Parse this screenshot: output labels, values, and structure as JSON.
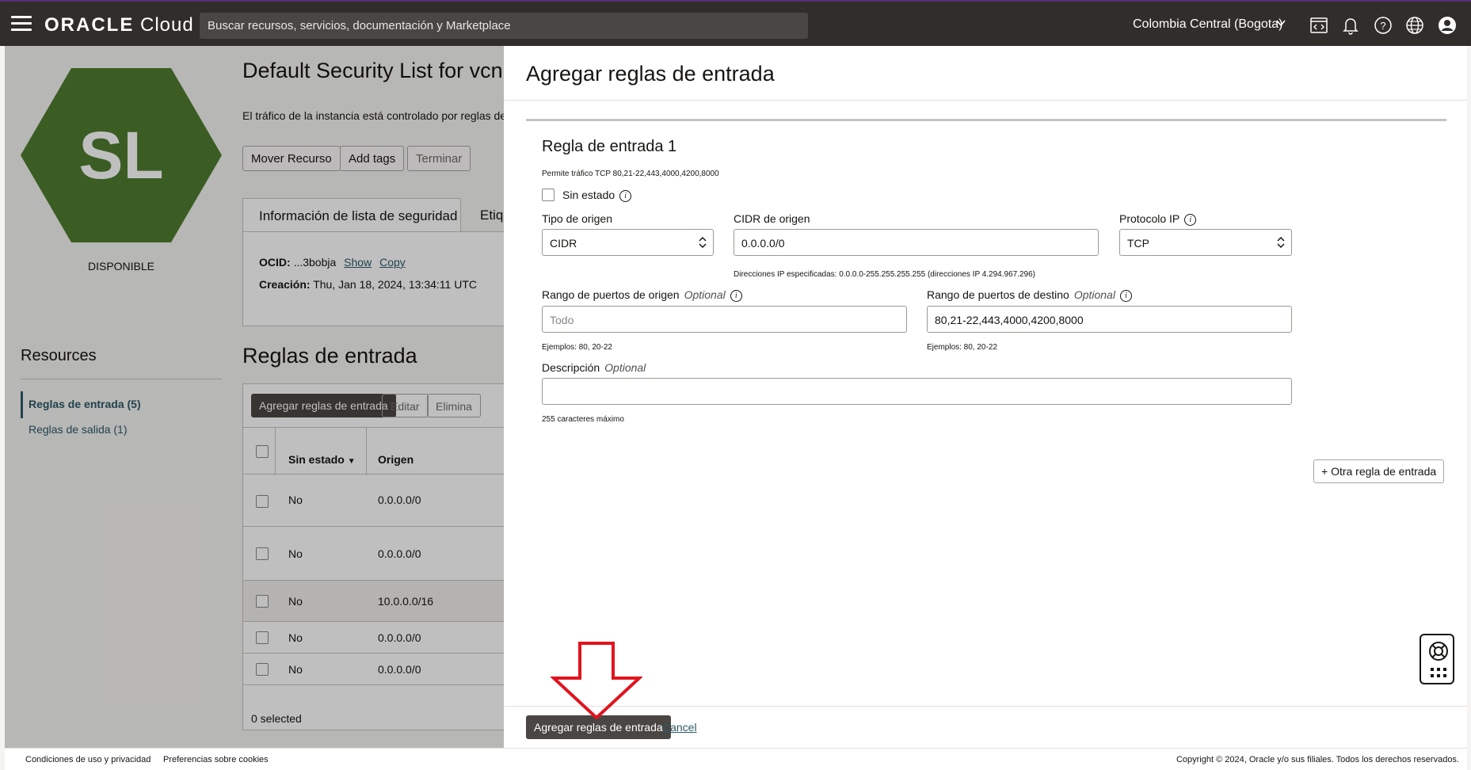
{
  "topbar": {
    "logo_brand": "ORACLE",
    "logo_product": "Cloud",
    "search_placeholder": "Buscar recursos, servicios, documentación y Marketplace",
    "region": "Colombia Central (Bogota)",
    "icons": [
      "code-editor-icon",
      "bell-icon",
      "help-icon",
      "globe-icon",
      "user-icon"
    ]
  },
  "resource": {
    "avatar_text": "SL",
    "avatar_color": "#4f7d30",
    "status": "DISPONIBLE",
    "title": "Default Security List for vcn",
    "description": "El tráfico de la instancia está controlado por reglas de",
    "actions": [
      "Mover Recurso",
      "Add tags",
      "Terminar"
    ],
    "tabs": [
      "Información de lista de seguridad",
      "Etiq"
    ],
    "ocid_label": "OCID:",
    "ocid_value": "...3bobja",
    "show_link": "Show",
    "copy_link": "Copy",
    "created_label": "Creación:",
    "created_value": "Thu, Jan 18, 2024, 13:34:11 UTC"
  },
  "resources_nav": {
    "title": "Resources",
    "items": [
      "Reglas de entrada (5)",
      "Reglas de salida (1)"
    ]
  },
  "rules_table": {
    "title": "Reglas de entrada",
    "buttons": [
      "Agregar reglas de entrada",
      "Editar",
      "Elimina"
    ],
    "columns": [
      "Sin estado",
      "Origen"
    ],
    "rows": [
      [
        "No",
        "0.0.0.0/0"
      ],
      [
        "No",
        "0.0.0.0/0"
      ],
      [
        "No",
        "10.0.0.0/16"
      ],
      [
        "No",
        "0.0.0.0/0"
      ],
      [
        "No",
        "0.0.0.0/0"
      ]
    ],
    "selected_count": "0 selected"
  },
  "panel": {
    "title": "Agregar reglas de entrada",
    "rule_title": "Regla de entrada 1",
    "rule_summary": "Permite tráfico TCP 80,21-22,443,4000,4200,8000",
    "stateless_label": "Sin estado",
    "source_type_label": "Tipo de origen",
    "source_type_value": "CIDR",
    "source_cidr_label": "CIDR de origen",
    "source_cidr_value": "0.0.0.0/0",
    "source_cidr_hint": "Direcciones IP especificadas: 0.0.0.0-255.255.255.255 (direcciones IP 4.294.967.296)",
    "ip_protocol_label": "Protocolo IP",
    "ip_protocol_value": "TCP",
    "src_port_label": "Rango de puertos de origen",
    "optional": "Optional",
    "src_port_placeholder": "Todo",
    "src_port_hint": "Ejemplos: 80, 20-22",
    "dst_port_label": "Rango de puertos de destino",
    "dst_port_value": "80,21-22,443,4000,4200,8000",
    "dst_port_hint": "Ejemplos: 80, 20-22",
    "description_label": "Descripción",
    "description_value": "",
    "description_hint": "255 caracteres máximo",
    "add_another": "+ Otra regla de entrada",
    "submit": "Agregar reglas de entrada",
    "cancel": "Cancel"
  },
  "footer": {
    "terms": "Condiciones de uso y privacidad",
    "cookies": "Preferencias sobre cookies",
    "copyright": "Copyright © 2024, Oracle y/o sus filiales. Todos los derechos reservados."
  },
  "colors": {
    "topbar": "#312d2a",
    "primary_button": "#4a4643",
    "link": "#2d5967",
    "annotation_arrow": "#e0141e"
  }
}
